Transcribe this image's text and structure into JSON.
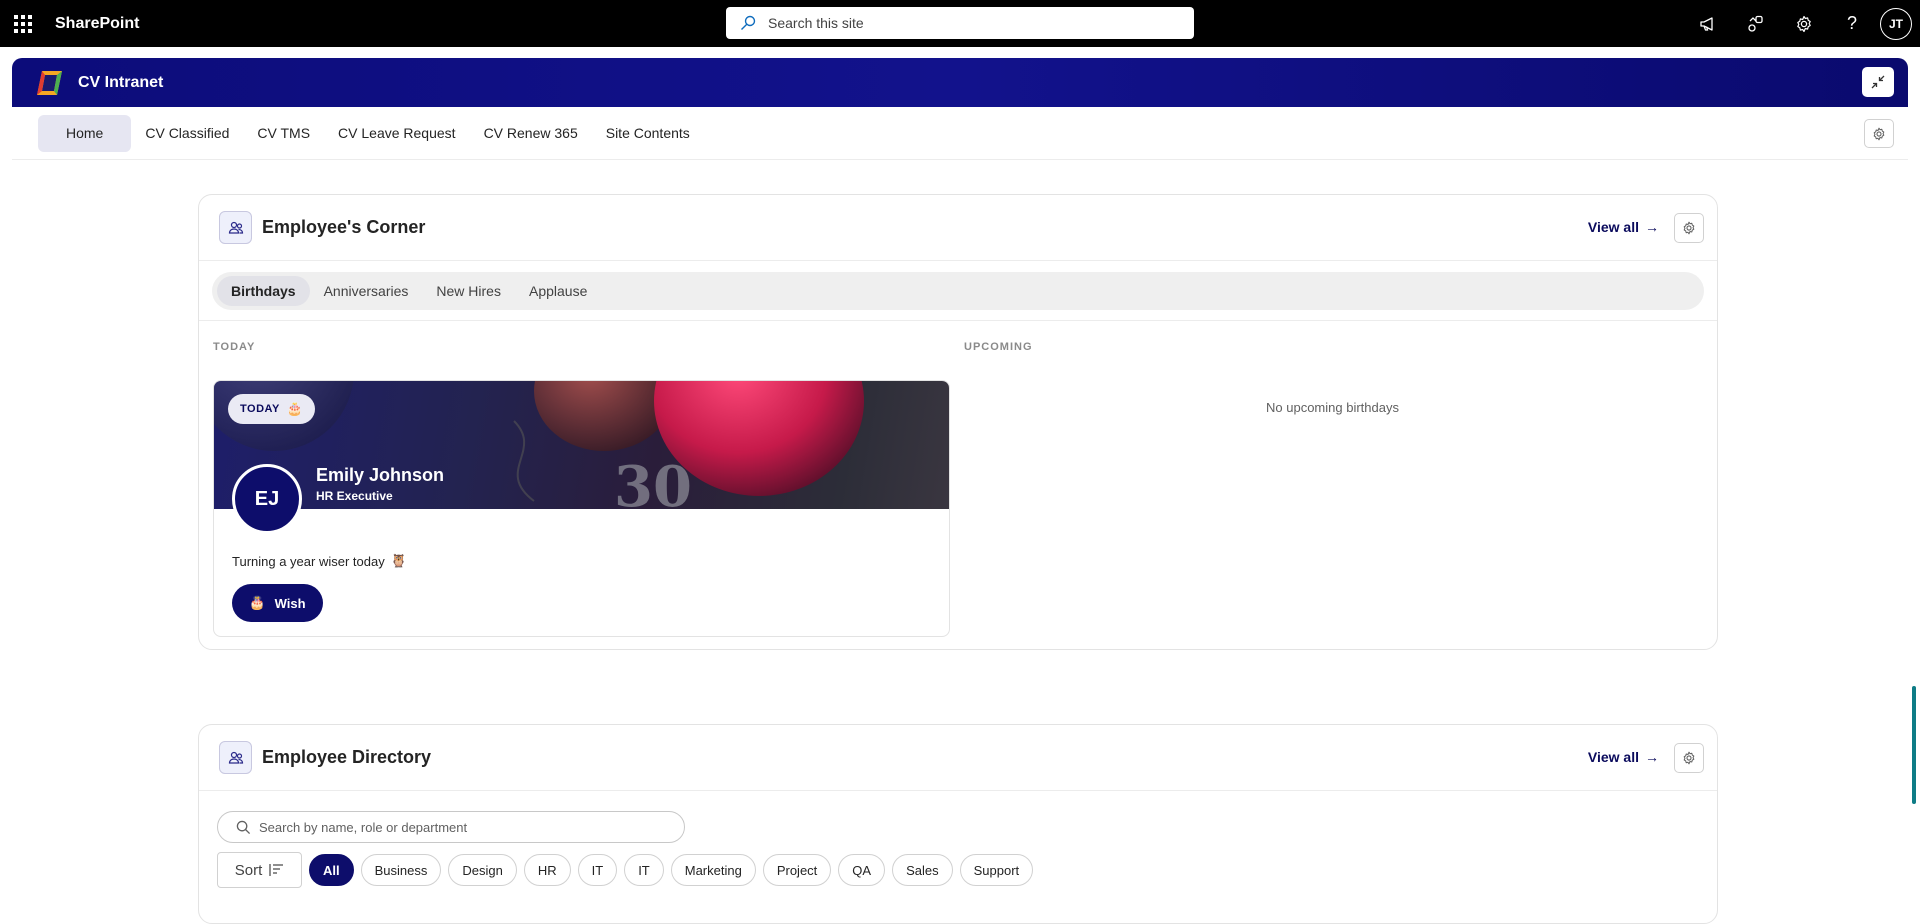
{
  "suitebar": {
    "app_name": "SharePoint",
    "search_placeholder": "Search this site",
    "user_initials": "JT"
  },
  "site": {
    "title": "CV Intranet"
  },
  "nav": {
    "items": [
      {
        "label": "Home",
        "active": true
      },
      {
        "label": "CV Classified"
      },
      {
        "label": "CV TMS"
      },
      {
        "label": "CV Leave Request"
      },
      {
        "label": "CV Renew 365"
      },
      {
        "label": "Site Contents"
      }
    ]
  },
  "employees_corner": {
    "title": "Employee's Corner",
    "view_all": "View all",
    "tabs": [
      "Birthdays",
      "Anniversaries",
      "New Hires",
      "Applause"
    ],
    "today_label": "TODAY",
    "upcoming_label": "UPCOMING",
    "no_upcoming": "No upcoming birthdays",
    "birthday": {
      "badge": "TODAY",
      "initials": "EJ",
      "name": "Emily Johnson",
      "role": "HR Executive",
      "message": "Turning a year wiser today",
      "wish_label": "Wish"
    }
  },
  "directory": {
    "title": "Employee Directory",
    "view_all": "View all",
    "search_placeholder": "Search by name, role or department",
    "sort_label": "Sort",
    "filters": [
      "All",
      "Business",
      "Design",
      "HR",
      "IT",
      "IT",
      "Marketing",
      "Project",
      "QA",
      "Sales",
      "Support"
    ]
  },
  "colors": {
    "brand_navy": "#0d0d6b",
    "header_gradient": "#12128c",
    "scroll_accent": "#0e7c86"
  }
}
